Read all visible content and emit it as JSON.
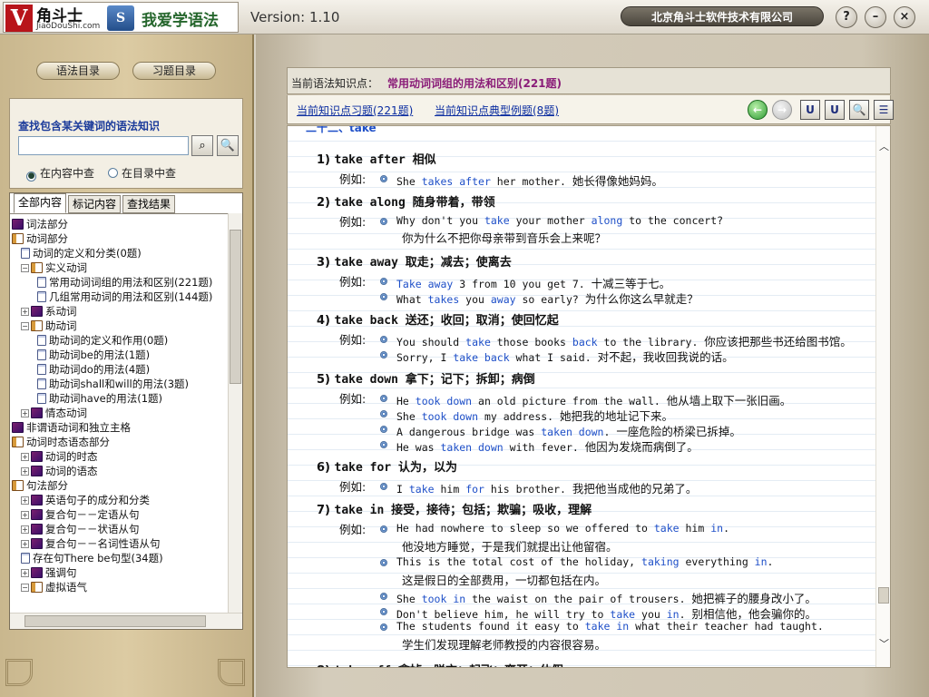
{
  "app": {
    "brand": "角斗士",
    "brand_site": "JiaoDouShi.com",
    "product_title": "我爱学语法",
    "version": "Version: 1.10",
    "company": "北京角斗士软件技术有限公司",
    "logo_v": "V",
    "logo_s": "S"
  },
  "window_buttons": {
    "help": "?",
    "minimize": "–",
    "close": "×"
  },
  "left": {
    "nav": {
      "grammar": "语法目录",
      "exercise": "习题目录"
    },
    "search": {
      "label": "查找包含某关键词的语法知识",
      "value": "",
      "radio_content": "在内容中查",
      "radio_catalog": "在目录中查"
    },
    "tabs": [
      "全部内容",
      "标记内容",
      "查找结果"
    ],
    "tree": [
      {
        "label": "词法部分",
        "type": "book",
        "level": 0,
        "expand": ""
      },
      {
        "label": "动词部分",
        "type": "open",
        "level": 0,
        "expand": ""
      },
      {
        "label": "动词的定义和分类(0题)",
        "type": "doc",
        "level": 1,
        "expand": ""
      },
      {
        "label": "实义动词",
        "type": "open",
        "level": 1,
        "expand": "−"
      },
      {
        "label": "常用动词词组的用法和区别(221题)",
        "type": "doc",
        "level": 2,
        "expand": ""
      },
      {
        "label": "几组常用动词的用法和区别(144题)",
        "type": "doc",
        "level": 2,
        "expand": ""
      },
      {
        "label": "系动词",
        "type": "book",
        "level": 1,
        "expand": "+"
      },
      {
        "label": "助动词",
        "type": "open",
        "level": 1,
        "expand": "−"
      },
      {
        "label": "助动词的定义和作用(0题)",
        "type": "doc",
        "level": 2,
        "expand": ""
      },
      {
        "label": "助动词be的用法(1题)",
        "type": "doc",
        "level": 2,
        "expand": ""
      },
      {
        "label": "助动词do的用法(4题)",
        "type": "doc",
        "level": 2,
        "expand": ""
      },
      {
        "label": "助动词shall和will的用法(3题)",
        "type": "doc",
        "level": 2,
        "expand": ""
      },
      {
        "label": "助动词have的用法(1题)",
        "type": "doc",
        "level": 2,
        "expand": ""
      },
      {
        "label": "情态动词",
        "type": "book",
        "level": 1,
        "expand": "+"
      },
      {
        "label": "非谓语动词和独立主格",
        "type": "book",
        "level": 0,
        "expand": ""
      },
      {
        "label": "动词时态语态部分",
        "type": "open",
        "level": 0,
        "expand": ""
      },
      {
        "label": "动词的时态",
        "type": "book",
        "level": 1,
        "expand": "+"
      },
      {
        "label": "动词的语态",
        "type": "book",
        "level": 1,
        "expand": "+"
      },
      {
        "label": "句法部分",
        "type": "open",
        "level": 0,
        "expand": ""
      },
      {
        "label": "英语句子的成分和分类",
        "type": "book",
        "level": 1,
        "expand": "+"
      },
      {
        "label": "复合句－－定语从句",
        "type": "book",
        "level": 1,
        "expand": "+"
      },
      {
        "label": "复合句－－状语从句",
        "type": "book",
        "level": 1,
        "expand": "+"
      },
      {
        "label": "复合句－－名词性语从句",
        "type": "book",
        "level": 1,
        "expand": "+"
      },
      {
        "label": "存在句There be句型(34题)",
        "type": "doc",
        "level": 1,
        "expand": ""
      },
      {
        "label": "强调句",
        "type": "book",
        "level": 1,
        "expand": "+"
      },
      {
        "label": "虚拟语气",
        "type": "open",
        "level": 1,
        "expand": "−"
      }
    ]
  },
  "right": {
    "current_label": "当前语法知识点：",
    "current_topic": "常用动词词组的用法和区别(221题)",
    "link_exercises": "当前知识点习题(221题)",
    "link_examples": "当前知识点典型例题(8题)",
    "toolbar": {
      "back": "←",
      "forward": "→",
      "u1": "U",
      "u2": "U",
      "find": "🔍",
      "list": "☰"
    },
    "cut_heading": "二十二、take",
    "example_label": "例如:",
    "entries": [
      {
        "num": "1)",
        "phrase": "take after",
        "zh": "相似",
        "lines": [
          {
            "bullet": true,
            "parts": [
              [
                "She ",
                0
              ],
              [
                "takes after",
                1
              ],
              [
                " her mother. ",
                0
              ]
            ],
            "zh": "她长得像她妈妈。"
          }
        ]
      },
      {
        "num": "2)",
        "phrase": "take along",
        "zh": "随身带着，带领",
        "lines": [
          {
            "bullet": true,
            "parts": [
              [
                "Why don't you ",
                0
              ],
              [
                "take",
                1
              ],
              [
                " your mother ",
                0
              ],
              [
                "along",
                1
              ],
              [
                " to the concert?",
                0
              ]
            ],
            "zh": ""
          },
          {
            "bullet": false,
            "parts": [],
            "zh": "你为什么不把你母亲带到音乐会上来呢？"
          }
        ]
      },
      {
        "num": "3)",
        "phrase": "take away",
        "zh": "取走；减去；使离去",
        "lines": [
          {
            "bullet": true,
            "parts": [
              [
                "Take away",
                1
              ],
              [
                " 3 from 10 you get 7. ",
                0
              ]
            ],
            "zh": "十减三等于七。"
          },
          {
            "bullet": true,
            "parts": [
              [
                "What ",
                0
              ],
              [
                "takes",
                1
              ],
              [
                " you ",
                0
              ],
              [
                "away",
                1
              ],
              [
                " so early? ",
                0
              ]
            ],
            "zh": "为什么你这么早就走？"
          }
        ]
      },
      {
        "num": "4)",
        "phrase": "take back",
        "zh": "送还；收回；取消；使回忆起",
        "lines": [
          {
            "bullet": true,
            "parts": [
              [
                "You should ",
                0
              ],
              [
                "take",
                1
              ],
              [
                " those books ",
                0
              ],
              [
                "back",
                1
              ],
              [
                " to the library. ",
                0
              ]
            ],
            "zh": "你应该把那些书还给图书馆。"
          },
          {
            "bullet": true,
            "parts": [
              [
                "Sorry, I ",
                0
              ],
              [
                "take back",
                1
              ],
              [
                " what I said. ",
                0
              ]
            ],
            "zh": "对不起，我收回我说的话。"
          }
        ]
      },
      {
        "num": "5)",
        "phrase": "take down",
        "zh": "拿下；记下；拆卸；病倒",
        "lines": [
          {
            "bullet": true,
            "parts": [
              [
                "He ",
                0
              ],
              [
                "took down",
                1
              ],
              [
                " an old picture from the wall. ",
                0
              ]
            ],
            "zh": "他从墙上取下一张旧画。"
          },
          {
            "bullet": true,
            "parts": [
              [
                "She ",
                0
              ],
              [
                "took down",
                1
              ],
              [
                " my address. ",
                0
              ]
            ],
            "zh": "她把我的地址记下来。"
          },
          {
            "bullet": true,
            "parts": [
              [
                "A dangerous bridge was ",
                0
              ],
              [
                "taken down",
                1
              ],
              [
                ". ",
                0
              ]
            ],
            "zh": "一座危险的桥梁已拆掉。"
          },
          {
            "bullet": true,
            "parts": [
              [
                "He was ",
                0
              ],
              [
                "taken down",
                1
              ],
              [
                " with fever. ",
                0
              ]
            ],
            "zh": "他因为发烧而病倒了。"
          }
        ]
      },
      {
        "num": "6)",
        "phrase": "take for",
        "zh": "认为，以为",
        "lines": [
          {
            "bullet": true,
            "parts": [
              [
                "I ",
                0
              ],
              [
                "take",
                1
              ],
              [
                " him ",
                0
              ],
              [
                "for",
                1
              ],
              [
                " his brother. ",
                0
              ]
            ],
            "zh": "我把他当成他的兄弟了。"
          }
        ]
      },
      {
        "num": "7)",
        "phrase": "take in",
        "zh": "接受，接待；包括；欺骗；吸收，理解",
        "lines": [
          {
            "bullet": true,
            "parts": [
              [
                "He had nowhere to sleep so we offered to ",
                0
              ],
              [
                "take",
                1
              ],
              [
                " him ",
                0
              ],
              [
                "in",
                1
              ],
              [
                ".",
                0
              ]
            ],
            "zh": ""
          },
          {
            "bullet": false,
            "parts": [],
            "zh": "他没地方睡觉，于是我们就提出让他留宿。"
          },
          {
            "bullet": true,
            "parts": [
              [
                "This is the total cost of the holiday, ",
                0
              ],
              [
                "taking",
                1
              ],
              [
                " everything ",
                0
              ],
              [
                "in",
                1
              ],
              [
                ".",
                0
              ]
            ],
            "zh": ""
          },
          {
            "bullet": false,
            "parts": [],
            "zh": "这是假日的全部费用，一切都包括在内。"
          },
          {
            "bullet": true,
            "parts": [
              [
                "She ",
                0
              ],
              [
                "took in",
                1
              ],
              [
                " the waist on the pair of trousers. ",
                0
              ]
            ],
            "zh": "她把裤子的腰身改小了。"
          },
          {
            "bullet": true,
            "parts": [
              [
                "Don't believe him, he will try to ",
                0
              ],
              [
                "take",
                1
              ],
              [
                " you ",
                0
              ],
              [
                "in",
                1
              ],
              [
                ". ",
                0
              ]
            ],
            "zh": "别相信他，他会骗你的。"
          },
          {
            "bullet": true,
            "parts": [
              [
                "The students found it easy to ",
                0
              ],
              [
                "take in",
                1
              ],
              [
                " what their teacher had taught.",
                0
              ]
            ],
            "zh": ""
          },
          {
            "bullet": false,
            "parts": [],
            "zh": "学生们发现理解老师教授的内容很容易。"
          }
        ]
      },
      {
        "num": "8)",
        "phrase": "take off",
        "zh": "拿掉，脱衣；起飞；离开；休假",
        "lines": []
      }
    ]
  }
}
